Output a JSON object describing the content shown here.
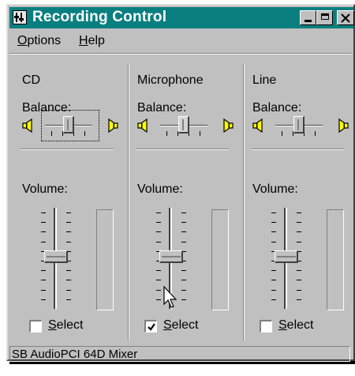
{
  "window": {
    "title": "Recording Control",
    "controls": {
      "minimize": "minimize-icon",
      "maximize": "maximize-icon",
      "close": "close-icon"
    }
  },
  "menu": [
    {
      "label": "Options",
      "accel": "O",
      "rest": "ptions"
    },
    {
      "label": "Help",
      "accel": "H",
      "rest": "elp"
    }
  ],
  "channels": [
    {
      "name": "CD",
      "balance_label": "Balance:",
      "volume_label": "Volume:",
      "select_label": "Select",
      "select_accel": "S",
      "select_rest": "elect",
      "selected": false,
      "balance_focused": true,
      "balance_greyed": false
    },
    {
      "name": "Microphone",
      "balance_label": "Balance:",
      "volume_label": "Volume:",
      "select_label": "Select",
      "select_accel": "S",
      "select_rest": "elect",
      "selected": true,
      "balance_focused": false,
      "balance_greyed": true
    },
    {
      "name": "Line",
      "balance_label": "Balance:",
      "volume_label": "Volume:",
      "select_label": "Select",
      "select_accel": "S",
      "select_rest": "elect",
      "selected": false,
      "balance_focused": false,
      "balance_greyed": false
    }
  ],
  "status": {
    "text": "SB AudioPCI 64D Mixer"
  },
  "colors": {
    "titlebar": "#0a7f80",
    "face": "#c0c0c0",
    "speaker": "#ffff00"
  }
}
